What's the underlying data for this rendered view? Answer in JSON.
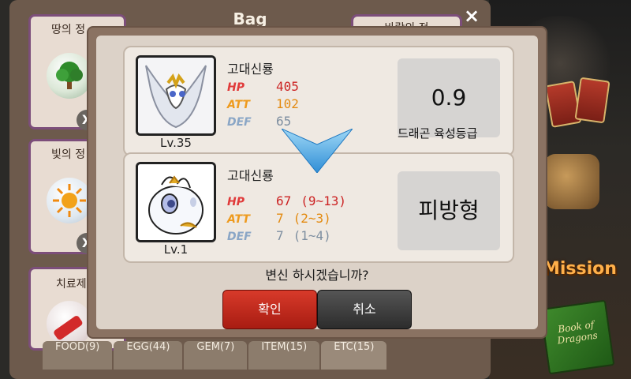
{
  "bag": {
    "title": "Bag",
    "close": "×",
    "left_items": [
      {
        "label": "땅의 정",
        "remove": "X"
      },
      {
        "label": "빛의 정",
        "remove": "X"
      },
      {
        "label": "치료제"
      }
    ],
    "right_item_label": "바람의 정"
  },
  "tabs": [
    {
      "label": "FOOD(9)"
    },
    {
      "label": "EGG(44)"
    },
    {
      "label": "GEM(7)"
    },
    {
      "label": "ITEM(15)"
    },
    {
      "label": "ETC(15)"
    }
  ],
  "background": {
    "mission_label": "Mission",
    "book_label": "Book of Dragons"
  },
  "dialog": {
    "current": {
      "name": "고대신룡",
      "level": "Lv.35",
      "stats": {
        "hp_label": "HP",
        "hp": "405",
        "att_label": "ATT",
        "att": "102",
        "def_label": "DEF",
        "def": "65"
      },
      "value": "0.9",
      "value_label": "드래곤 육성등급"
    },
    "result": {
      "name": "고대신룡",
      "level": "Lv.1",
      "stats": {
        "hp_label": "HP",
        "hp": "67",
        "hp_range": "(9~13)",
        "att_label": "ATT",
        "att": "7",
        "att_range": "(2~3)",
        "def_label": "DEF",
        "def": "7",
        "def_range": "(1~4)"
      },
      "type": "피방형"
    },
    "question": "변신 하시겠습니까?",
    "confirm": "확인",
    "cancel": "취소"
  }
}
